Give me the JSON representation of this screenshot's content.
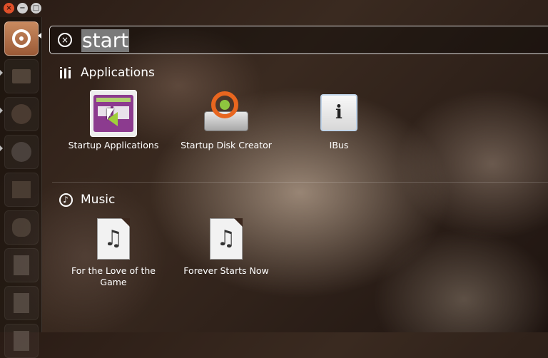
{
  "window_controls": {
    "close": "×",
    "minimize": "−",
    "maximize": "□"
  },
  "search": {
    "query": "start",
    "clear_glyph": "×"
  },
  "categories": [
    {
      "title": "Applications"
    },
    {
      "title": "Music"
    }
  ],
  "applications": [
    {
      "label": "Startup Applications"
    },
    {
      "label": "Startup Disk Creator"
    },
    {
      "label": "IBus",
      "glyph": "i"
    }
  ],
  "music": [
    {
      "label": "For the Love of the Game",
      "glyph": "♫"
    },
    {
      "label": "Forever Starts Now",
      "glyph": "♫"
    }
  ],
  "music_icon_glyph": "♪",
  "launcher": {
    "items": [
      "ubuntu-button",
      "files",
      "firefox",
      "chromium",
      "file-manager",
      "pidgin",
      "document",
      "presentation",
      "spreadsheet"
    ]
  }
}
